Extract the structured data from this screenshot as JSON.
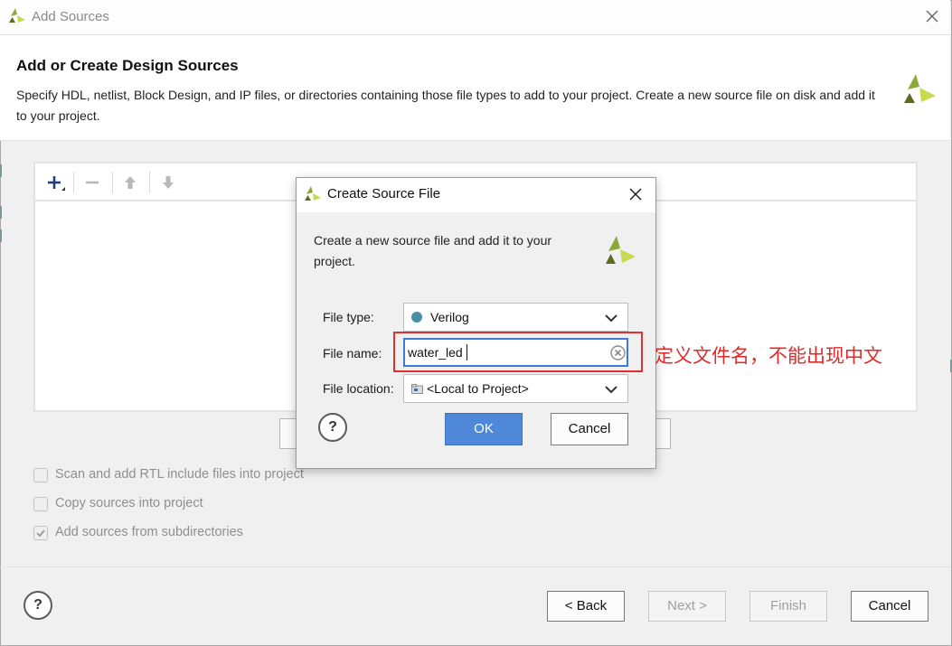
{
  "window": {
    "title": "Add Sources",
    "heading": "Add or Create Design Sources",
    "description": "Specify HDL, netlist, Block Design, and IP files, or directories containing those file types to add to your project. Create a new source file on disk and add it to your project."
  },
  "toolbar": {
    "add_icon": "plus-icon",
    "remove_icon": "minus-icon",
    "up_icon": "arrow-up-icon",
    "down_icon": "arrow-down-icon"
  },
  "options": [
    {
      "label": "Scan and add RTL include files into project",
      "checked": false
    },
    {
      "label": "Copy sources into project",
      "checked": false
    },
    {
      "label": "Add sources from subdirectories",
      "checked": true
    }
  ],
  "buttons": {
    "help": "?",
    "back": "< Back",
    "next": "Next >",
    "finish": "Finish",
    "cancel": "Cancel"
  },
  "dialog": {
    "title": "Create Source File",
    "description": "Create a new source file and add it to your project.",
    "file_type_label": "File type:",
    "file_type_value": "Verilog",
    "file_name_label": "File name:",
    "file_name_value": "water_led",
    "file_location_label": "File location:",
    "file_location_value": "<Local to Project>",
    "help": "?",
    "ok": "OK",
    "cancel": "Cancel"
  },
  "annotation": {
    "text": "定义文件名，不能出现中文"
  },
  "colors": {
    "accent_blue": "#4f87d9",
    "annotation_red": "#e03030",
    "logo_green": "#8ea83a",
    "logo_dark": "#5b6b1f",
    "logo_yellow": "#c9d94f",
    "verilog_dot": "#4a8fa8"
  }
}
